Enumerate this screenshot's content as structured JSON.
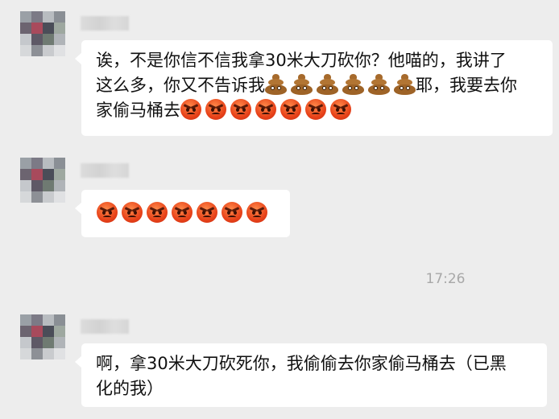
{
  "messages": [
    {
      "lines": [
        "诶，不是你信不信我拿30米大刀砍你？他喵的，我讲了",
        "这么多，你又不告诉我",
        "耶，我要去你",
        "家偷马桶去"
      ],
      "emoji": {
        "poop_count": 6,
        "angry_count_line3": 7,
        "angry_count_only": 0
      }
    },
    {
      "lines": [],
      "emoji": {
        "angry_count_only": 7
      }
    },
    {
      "lines": [
        "啊，拿30米大刀砍死你，我偷偷去你家偷马桶去（已黑",
        "化的我）"
      ]
    }
  ],
  "timestamp": "17:26",
  "icons": {
    "poop": "pile-of-poo-emoji",
    "angry": "angry-face-emoji"
  },
  "colors": {
    "background": "#ededed",
    "bubble": "#ffffff",
    "timestamp": "#a8a8a8"
  }
}
